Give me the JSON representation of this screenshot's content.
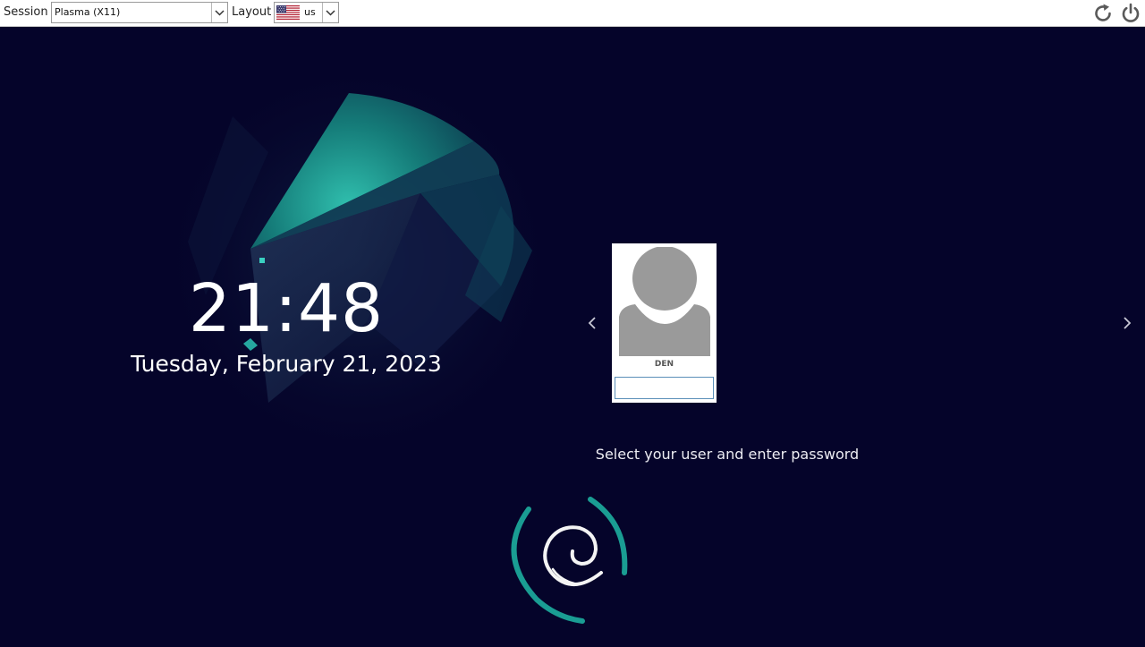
{
  "topbar": {
    "session_label": "Session",
    "session_value": "Plasma (X11)",
    "layout_label": "Layout",
    "layout_value": "us",
    "icons": [
      "us-flag-icon",
      "restart-icon",
      "power-icon"
    ]
  },
  "clock": {
    "time": "21:48",
    "date": "Tuesday, February 21, 2023"
  },
  "user": {
    "name": "DEN",
    "password_value": ""
  },
  "prompt": "Select your user and enter password",
  "colors": {
    "background": "#05042a",
    "accent": "#1fa39a",
    "topbar": "#ffffff",
    "text": "#ffffff"
  }
}
